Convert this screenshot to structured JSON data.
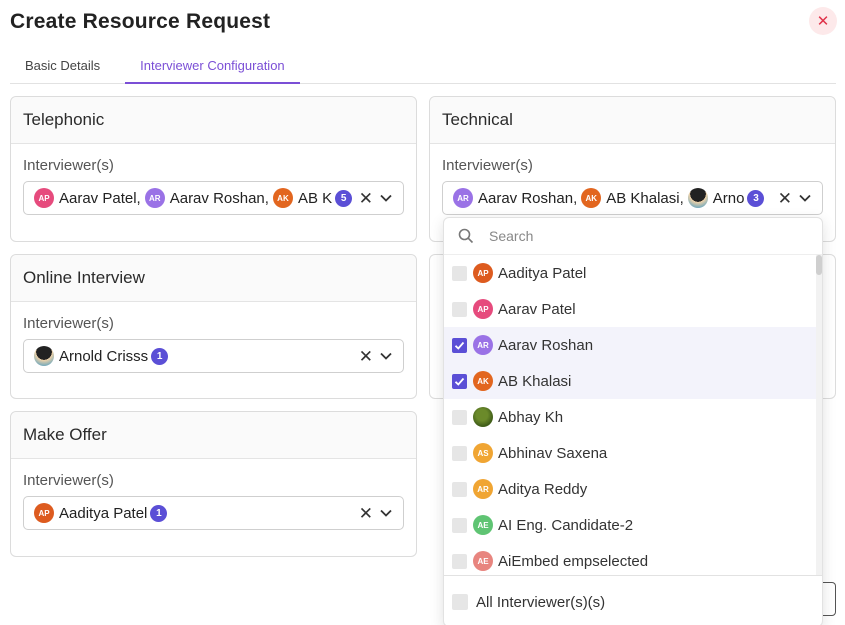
{
  "page": {
    "title": "Create Resource Request"
  },
  "tabs": [
    {
      "label": "Basic Details",
      "active": false
    },
    {
      "label": "Interviewer Configuration",
      "active": true
    }
  ],
  "cards": {
    "telephonic": {
      "title": "Telephonic",
      "label": "Interviewer(s)",
      "chips": [
        {
          "initials": "AP",
          "name": "Aarav Patel"
        },
        {
          "initials": "AR",
          "name": "Aarav Roshan"
        },
        {
          "initials": "AK",
          "name": "AB K"
        }
      ],
      "count": "5"
    },
    "technical": {
      "title": "Technical",
      "label": "Interviewer(s)",
      "chips": [
        {
          "initials": "AR",
          "name": "Aarav Roshan"
        },
        {
          "initials": "AK",
          "name": "AB Khalasi"
        },
        {
          "initials": "",
          "name": "Arno"
        }
      ],
      "count": "3"
    },
    "online": {
      "title": "Online Interview",
      "label": "Interviewer(s)",
      "chips": [
        {
          "initials": "",
          "name": "Arnold Crisss"
        }
      ],
      "count": "1"
    },
    "offer": {
      "title": "Make Offer",
      "label": "Interviewer(s)",
      "chips": [
        {
          "initials": "AP",
          "name": "Aaditya Patel"
        }
      ],
      "count": "1"
    }
  },
  "dropdown": {
    "search_placeholder": "Search",
    "options": [
      {
        "initials": "AP",
        "name": "Aaditya Patel",
        "checked": false
      },
      {
        "initials": "AP",
        "name": "Aarav Patel",
        "checked": false
      },
      {
        "initials": "AR",
        "name": "Aarav Roshan",
        "checked": true
      },
      {
        "initials": "AK",
        "name": "AB Khalasi",
        "checked": true
      },
      {
        "initials": "",
        "name": "Abhay Kh",
        "checked": false
      },
      {
        "initials": "AS",
        "name": "Abhinav Saxena",
        "checked": false
      },
      {
        "initials": "AR",
        "name": "Aditya Reddy",
        "checked": false
      },
      {
        "initials": "AE",
        "name": "AI Eng. Candidate-2",
        "checked": false
      },
      {
        "initials": "AE",
        "name": "AiEmbed empselected",
        "checked": false
      }
    ],
    "footer_label": "All Interviewer(s)(s)"
  },
  "icons": {
    "close": "close-icon",
    "clear": "x-icon",
    "chevron": "chevron-down-icon",
    "search": "search-icon",
    "check": "check-icon"
  },
  "colors": {
    "accent": "#7b4fd6",
    "badge": "#5b4fd6",
    "close": "#e0334a"
  }
}
